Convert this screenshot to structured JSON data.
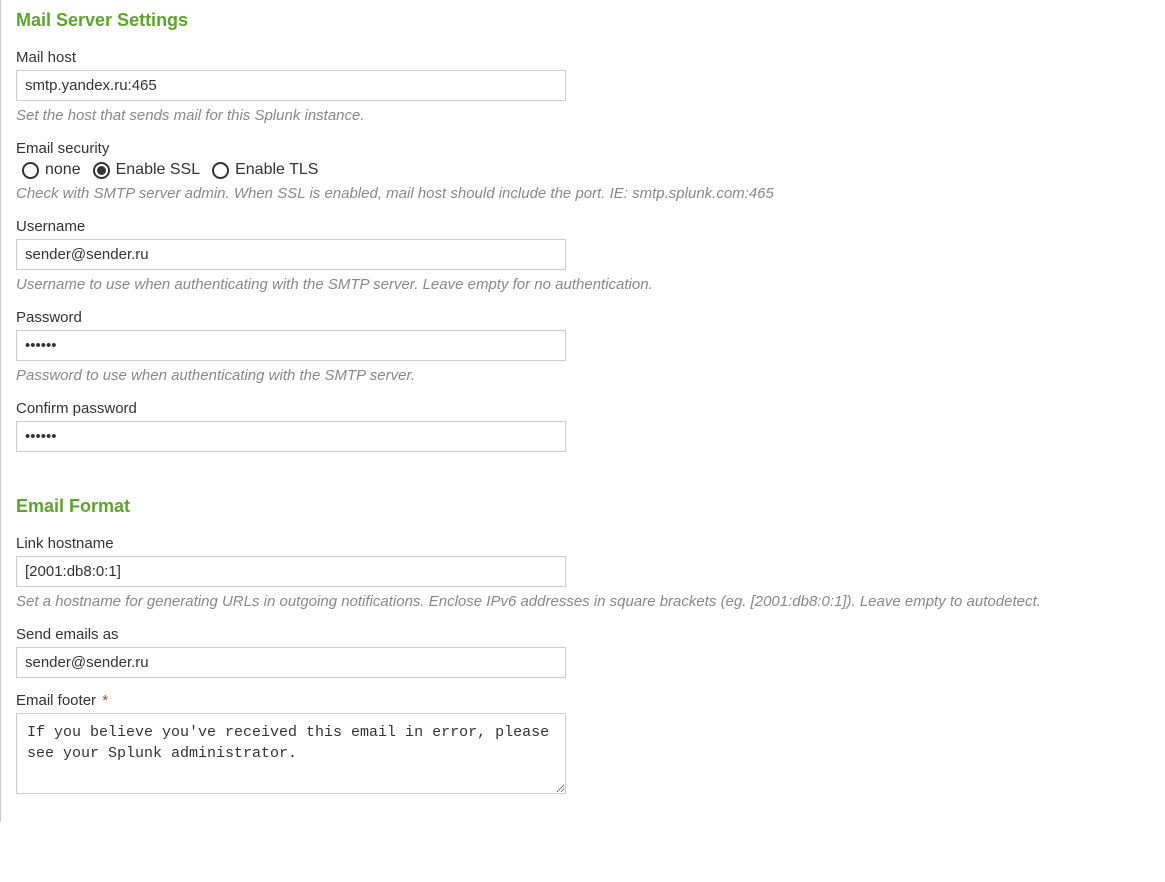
{
  "mailServer": {
    "header": "Mail Server Settings",
    "mailHost": {
      "label": "Mail host",
      "value": "smtp.yandex.ru:465",
      "helper": "Set the host that sends mail for this Splunk instance."
    },
    "emailSecurity": {
      "label": "Email security",
      "options": {
        "none": "none",
        "ssl": "Enable SSL",
        "tls": "Enable TLS"
      },
      "selected": "ssl",
      "helper": "Check with SMTP server admin. When SSL is enabled, mail host should include the port. IE: smtp.splunk.com:465"
    },
    "username": {
      "label": "Username",
      "value": "sender@sender.ru",
      "helper": "Username to use when authenticating with the SMTP server. Leave empty for no authentication."
    },
    "password": {
      "label": "Password",
      "value": "••••••",
      "helper": "Password to use when authenticating with the SMTP server."
    },
    "confirmPassword": {
      "label": "Confirm password",
      "value": "••••••"
    }
  },
  "emailFormat": {
    "header": "Email Format",
    "linkHostname": {
      "label": "Link hostname",
      "value": "[2001:db8:0:1]",
      "helper": "Set a hostname for generating URLs in outgoing notifications. Enclose IPv6 addresses in square brackets (eg. [2001:db8:0:1]). Leave empty to autodetect."
    },
    "sendEmailsAs": {
      "label": "Send emails as",
      "value": "sender@sender.ru"
    },
    "emailFooter": {
      "label": "Email footer",
      "required": "*",
      "value": "If you believe you've received this email in error, please see your Splunk administrator."
    }
  }
}
